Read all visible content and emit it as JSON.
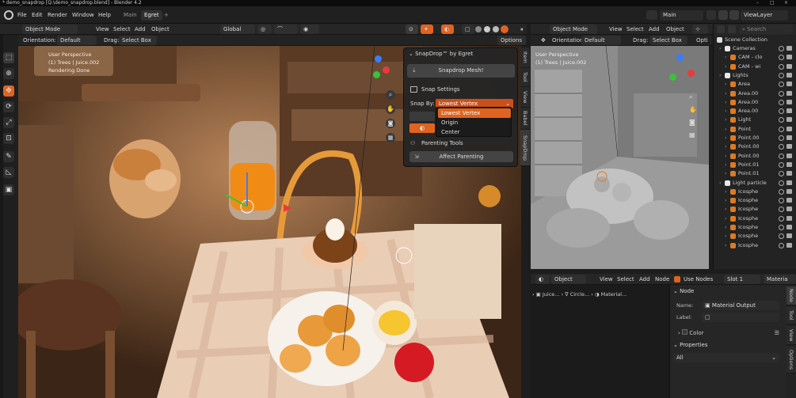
{
  "window": {
    "title": "* demo_snapdrop [Q:\\demo_snapdrop.blend] - Blender 4.2",
    "controls": [
      "–",
      "□",
      "×"
    ]
  },
  "topbar": {
    "menus": [
      "File",
      "Edit",
      "Render",
      "Window",
      "Help"
    ],
    "workspaces": [
      "Main",
      "Egret"
    ],
    "active_workspace": "Egret",
    "add_tab": "+",
    "scene_name": "Main",
    "view_layer": "ViewLayer"
  },
  "viewport_left": {
    "mode": "Object Mode",
    "menus": [
      "View",
      "Select",
      "Add",
      "Object"
    ],
    "transform_orientation": "Global",
    "orientation_label": "Orientation:",
    "orientation_value": "Default",
    "drag_label": "Drag:",
    "drag_value": "Select Box",
    "options": "Options",
    "overlay_lines": [
      "User Perspective",
      "(1) Trees | Juice.002",
      "Rendering Done"
    ],
    "side_tabs": [
      "Item",
      "Tool",
      "View",
      "Babel",
      "SnapDrop"
    ]
  },
  "snapdrop": {
    "title": "SnapDrop™ by Egret",
    "snap_mesh_button": "Snapdrop Mesh!",
    "snap_settings": "Snap Settings",
    "snap_by_label": "Snap By:",
    "snap_by_value": "Lowest Vertex",
    "dropdown_options": [
      "Lowest Vertex",
      "Origin",
      "Center"
    ],
    "selected_option": "Lowest Vertex",
    "parenting_tools": "Parenting Tools",
    "affect_parenting": "Affect Parenting"
  },
  "viewport_right": {
    "mode": "Object Mode",
    "menus": [
      "View",
      "Select",
      "Add",
      "Object"
    ],
    "orientation_label": "Orientation:",
    "orientation_value": "Default",
    "drag_label": "Drag:",
    "drag_value": "Select Box",
    "options": "Opti",
    "overlay_lines": [
      "User Perspective",
      "(1) Trees | Juice.002"
    ]
  },
  "outliner": {
    "search_placeholder": "Search",
    "root": "Scene Collection",
    "rows": [
      {
        "label": "Cameras",
        "kind": "collection",
        "indent": 1
      },
      {
        "label": "CAM - clo",
        "kind": "camera",
        "indent": 2
      },
      {
        "label": "CAM - wi",
        "kind": "camera",
        "indent": 2
      },
      {
        "label": "Lights",
        "kind": "collection",
        "indent": 1
      },
      {
        "label": "Area",
        "kind": "light",
        "indent": 2
      },
      {
        "label": "Area.00",
        "kind": "light",
        "indent": 2
      },
      {
        "label": "Area.00",
        "kind": "light",
        "indent": 2
      },
      {
        "label": "Area.00",
        "kind": "light",
        "indent": 2
      },
      {
        "label": "Light",
        "kind": "light",
        "indent": 2
      },
      {
        "label": "Point",
        "kind": "light",
        "indent": 2
      },
      {
        "label": "Point.00",
        "kind": "light",
        "indent": 2
      },
      {
        "label": "Point.00",
        "kind": "light",
        "indent": 2
      },
      {
        "label": "Point.00",
        "kind": "light",
        "indent": 2
      },
      {
        "label": "Point.01",
        "kind": "light",
        "indent": 2
      },
      {
        "label": "Point.01",
        "kind": "light",
        "indent": 2
      },
      {
        "label": "Light particle",
        "kind": "collection",
        "indent": 1
      },
      {
        "label": "Icosphe",
        "kind": "mesh",
        "indent": 2
      },
      {
        "label": "Icosphe",
        "kind": "mesh",
        "indent": 2
      },
      {
        "label": "Icosphe",
        "kind": "mesh",
        "indent": 2
      },
      {
        "label": "Icosphe",
        "kind": "mesh",
        "indent": 2
      },
      {
        "label": "Icosphe",
        "kind": "mesh",
        "indent": 2
      },
      {
        "label": "Icosphe",
        "kind": "mesh",
        "indent": 2
      },
      {
        "label": "Icosphe",
        "kind": "mesh",
        "indent": 2
      }
    ]
  },
  "node_editor": {
    "type": "Object",
    "menus": [
      "View",
      "Select",
      "Add",
      "Node"
    ],
    "use_nodes": "Use Nodes",
    "slot": "Slot 1",
    "material": "Materia",
    "breadcrumb": [
      "Juice...",
      "Circle...",
      "Material..."
    ],
    "side_tabs": [
      "Node",
      "Tool",
      "View",
      "Options"
    ]
  },
  "node_panel": {
    "node_header": "Node",
    "name_label": "Name:",
    "name_value": "Material Output",
    "label_label": "Label:",
    "label_value": "",
    "color_label": "Color",
    "properties_header": "Properties",
    "properties_value": "All"
  },
  "colors": {
    "accent": "#e06320",
    "panel": "#252525",
    "header": "#262626",
    "background": "#1d1d1d"
  }
}
